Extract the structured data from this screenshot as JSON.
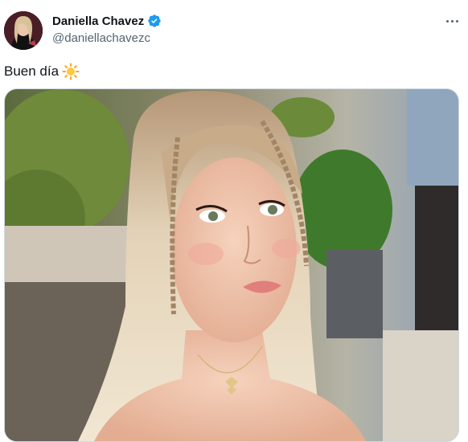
{
  "author": {
    "display_name": "Daniella Chavez",
    "handle": "@daniellachavezc",
    "verified": true,
    "avatar_icon": "profile-photo"
  },
  "tweet": {
    "text": "Buen día",
    "emoji_icon": "sun-icon"
  },
  "media": {
    "type": "photo",
    "alt_icon": "portrait-photo"
  },
  "colors": {
    "verified_blue": "#1d9bf0",
    "secondary_text": "#536471",
    "primary_text": "#0f1419"
  }
}
